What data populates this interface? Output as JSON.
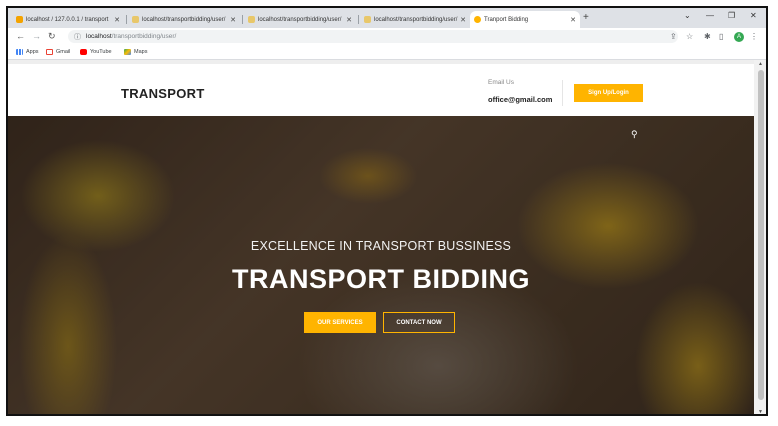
{
  "browser": {
    "tabs": [
      {
        "title": "localhost / 127.0.0.1 / transport",
        "favicon_color": "#f4a300"
      },
      {
        "title": "localhost/transportbidding/user/",
        "favicon_color": "#e8c76a"
      },
      {
        "title": "localhost/transportbidding/user/",
        "favicon_color": "#e8c76a"
      },
      {
        "title": "localhost/transportbidding/user/",
        "favicon_color": "#e8c76a"
      },
      {
        "title": "Tranport Bidding",
        "favicon_color": "#ffb400"
      }
    ],
    "address": {
      "host": "localhost",
      "path": "/transportbidding/user/"
    },
    "bookmarks": [
      {
        "label": "Apps",
        "icon": "apps-grid-icon"
      },
      {
        "label": "Gmail",
        "icon": "gmail-icon"
      },
      {
        "label": "YouTube",
        "icon": "youtube-icon"
      },
      {
        "label": "Maps",
        "icon": "maps-icon"
      }
    ],
    "profile_initial": "A"
  },
  "site": {
    "brand": "TRANSPORT",
    "email_label": "Email Us",
    "email": "office@gmail.com",
    "signup_label": "Sign Up/Login",
    "accent_color": "#ffb400"
  },
  "hero": {
    "subtitle": "EXCELLENCE IN TRANSPORT BUSSINESS",
    "title": "TRANSPORT BIDDING",
    "primary_button": "OUR SERVICES",
    "secondary_button": "CONTACT NOW"
  }
}
